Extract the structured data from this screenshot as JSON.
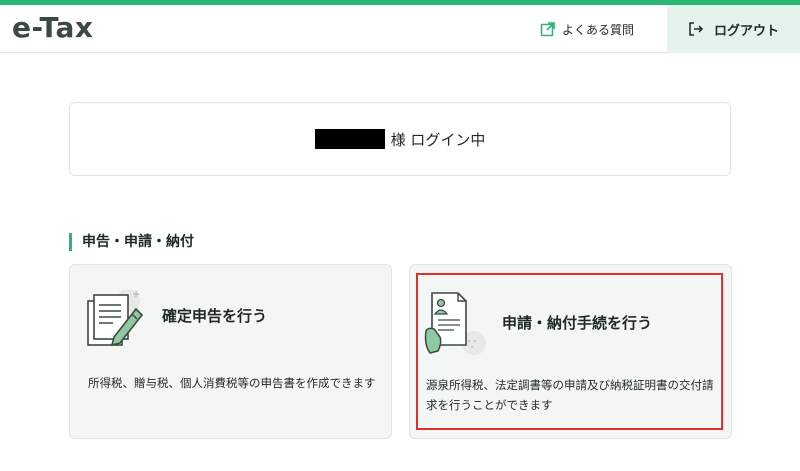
{
  "header": {
    "logo": "e-Tax",
    "faq_label": "よくある質問",
    "logout_label": "ログアウト",
    "accent_color": "#2bb673"
  },
  "login_status": {
    "suffix": "様 ログイン中"
  },
  "section": {
    "title": "申告・申請・納付"
  },
  "cards": [
    {
      "icon": "document-pen-icon",
      "title": "確定申告を行う",
      "description": "所得税、贈与税、個人消費税等の申告書を作成できます"
    },
    {
      "icon": "document-person-hand-icon",
      "title": "申請・納付手続を行う",
      "description": "源泉所得税、法定調書等の申請及び納税証明書の交付請求を行うことができます"
    }
  ]
}
